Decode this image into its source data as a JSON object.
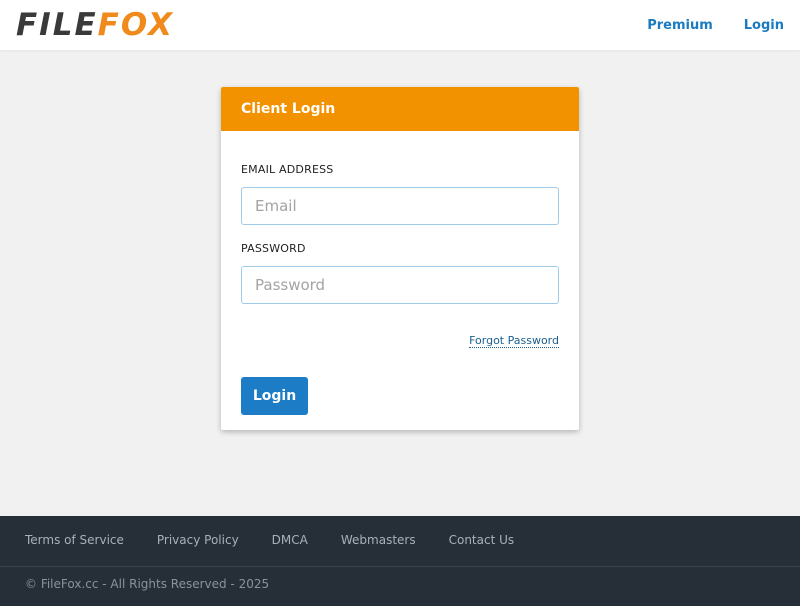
{
  "header": {
    "logo_part1": "FILE",
    "logo_part2": "FOX",
    "nav": {
      "premium": "Premium",
      "login": "Login"
    }
  },
  "login_card": {
    "title": "Client Login",
    "email_label": "EMAIL ADDRESS",
    "email_placeholder": "Email",
    "email_value": "",
    "password_label": "PASSWORD",
    "password_placeholder": "Password",
    "password_value": "",
    "forgot_link": "Forgot Password",
    "submit_label": "Login"
  },
  "footer": {
    "links": [
      "Terms of Service",
      "Privacy Policy",
      "DMCA",
      "Webmasters",
      "Contact Us"
    ],
    "copyright": "© FileFox.cc - All Rights Reserved - 2025"
  },
  "colors": {
    "accent_orange": "#f39200",
    "link_blue": "#1a7bbf",
    "button_blue": "#1c7cc6",
    "footer_bg": "#262e38",
    "page_bg": "#f1f1f1"
  },
  "icons": [
    "filefox-logo"
  ]
}
